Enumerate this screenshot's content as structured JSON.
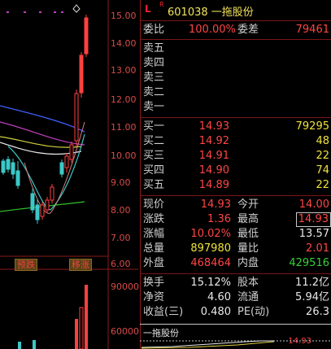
{
  "chart": {
    "price_ticks": [
      "15.00",
      "14.00",
      "13.00",
      "12.00",
      "11.00",
      "10.00",
      "9.00",
      "8.00",
      "7.00",
      "6.00"
    ],
    "volume_ticks": [
      "90000",
      "60000"
    ],
    "tag_down": "预跌",
    "tag_up": "移涨"
  },
  "quote": {
    "L": "L",
    "R": "R",
    "title": "601038 一拖股份",
    "weibi_label": "委比",
    "weibi_value": "100.00%",
    "weicha_label": "委差",
    "weicha_value": "79461",
    "sell": [
      {
        "label": "卖五",
        "price": "",
        "vol": ""
      },
      {
        "label": "卖四",
        "price": "",
        "vol": ""
      },
      {
        "label": "卖三",
        "price": "",
        "vol": ""
      },
      {
        "label": "卖二",
        "price": "",
        "vol": ""
      },
      {
        "label": "卖一",
        "price": "",
        "vol": ""
      }
    ],
    "buy": [
      {
        "label": "买一",
        "price": "14.93",
        "vol": "79295"
      },
      {
        "label": "买二",
        "price": "14.92",
        "vol": "48"
      },
      {
        "label": "买三",
        "price": "14.91",
        "vol": "22"
      },
      {
        "label": "买四",
        "price": "14.90",
        "vol": "74"
      },
      {
        "label": "买五",
        "price": "14.89",
        "vol": "22"
      }
    ],
    "stats": [
      {
        "l1": "现价",
        "v1": "14.93",
        "c1": "red",
        "l2": "今开",
        "v2": "14.00",
        "c2": "red"
      },
      {
        "l1": "涨跌",
        "v1": "1.36",
        "c1": "red",
        "l2": "最高",
        "v2": "14.93",
        "c2": "red"
      },
      {
        "l1": "涨幅",
        "v1": "10.02%",
        "c1": "red",
        "l2": "最低",
        "v2": "13.57",
        "c2": "wht"
      },
      {
        "l1": "总量",
        "v1": "897980",
        "c1": "yel",
        "l2": "量比",
        "v2": "2.01",
        "c2": "red"
      },
      {
        "l1": "外盘",
        "v1": "468464",
        "c1": "red",
        "l2": "内盘",
        "v2": "429516",
        "c2": "grn"
      }
    ],
    "fin": [
      {
        "l1": "换手",
        "v1": "15.12%",
        "l2": "股本",
        "v2": "11.2亿"
      },
      {
        "l1": "净资",
        "v1": "4.60",
        "l2": "流通",
        "v2": "5.94亿"
      },
      {
        "l1": "收益(三)",
        "v1": "0.480",
        "l2": "PE(动)",
        "v2": "26.3"
      }
    ],
    "mini_title": "一拖股份",
    "mini_price": "14.93"
  },
  "colors": {
    "accent_red": "#ff4545",
    "yellow": "#f0e23a",
    "green": "#35d235"
  }
}
